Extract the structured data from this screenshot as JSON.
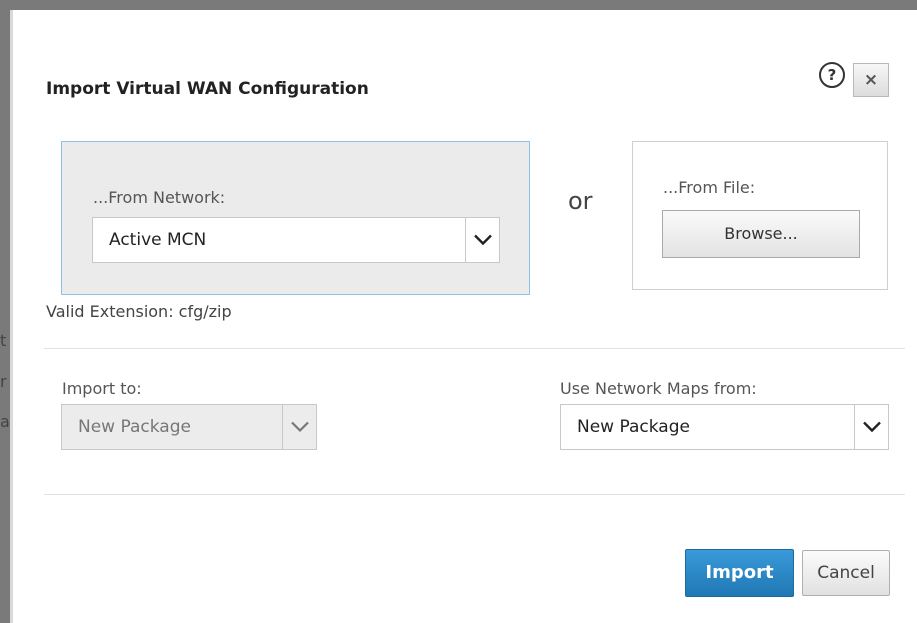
{
  "dialog": {
    "title": "Import Virtual WAN Configuration",
    "help_icon": "?",
    "close_icon": "×"
  },
  "from_network": {
    "label": "...From Network:",
    "selected": "Active MCN"
  },
  "or_text": "or",
  "from_file": {
    "label": "...From File:",
    "browse_label": "Browse..."
  },
  "valid_extension": "Valid Extension: cfg/zip",
  "import_to": {
    "label": "Import to:",
    "selected": "New Package"
  },
  "network_maps": {
    "label": "Use Network Maps from:",
    "selected": "New Package"
  },
  "buttons": {
    "import": "Import",
    "cancel": "Cancel"
  },
  "background_fragments": [
    "t",
    "r",
    "a"
  ],
  "colors": {
    "primary_button": "#2583c4",
    "network_box_bg": "#ebebeb",
    "network_box_border": "#8cc3e9"
  }
}
